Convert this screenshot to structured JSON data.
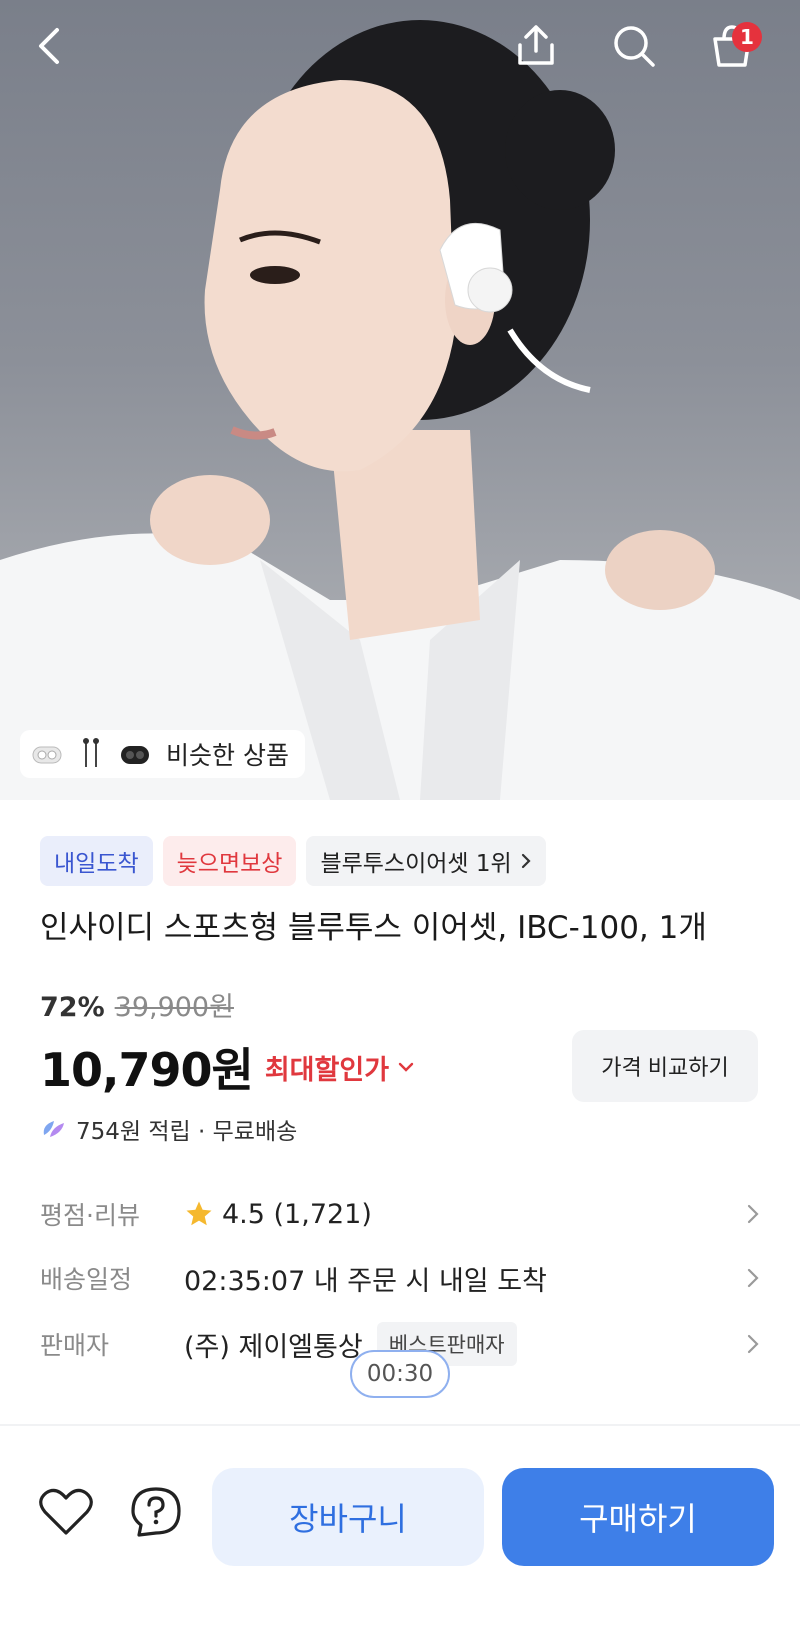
{
  "header": {
    "cart_count": "1",
    "icons": [
      "back-arrow-icon",
      "share-icon",
      "search-icon",
      "shopping-bag-icon"
    ]
  },
  "hero": {
    "similar_label": "비슷한 상품"
  },
  "badges": {
    "arrival": "내일도착",
    "late_compensation": "늦으면보상",
    "ranking": "블루투스이어셋 1위"
  },
  "product": {
    "title": "인사이디 스포츠형 블루투스 이어셋, IBC-100, 1개",
    "discount_rate": "72%",
    "original_price": "39,900원",
    "price": "10,790원",
    "max_discount_label": "최대할인가",
    "compare_button": "가격 비교하기",
    "reward": "754원 적립 · 무료배송"
  },
  "meta": {
    "rating_label": "평점·리뷰",
    "rating_value": "4.5 (1,721)",
    "delivery_label": "배송일정",
    "delivery_value": "02:35:07 내 주문 시 내일 도착",
    "seller_label": "판매자",
    "seller_value": "(주) 제이엘통상",
    "seller_tag": "베스트판매자"
  },
  "timer": "00:30",
  "actions": {
    "add_to_cart": "장바구니",
    "buy_now": "구매하기"
  },
  "colors": {
    "accent_blue": "#3e7fe8",
    "sale_red": "#e0383e",
    "badge_blue": "#3a56d0",
    "star": "#f5b82e"
  }
}
